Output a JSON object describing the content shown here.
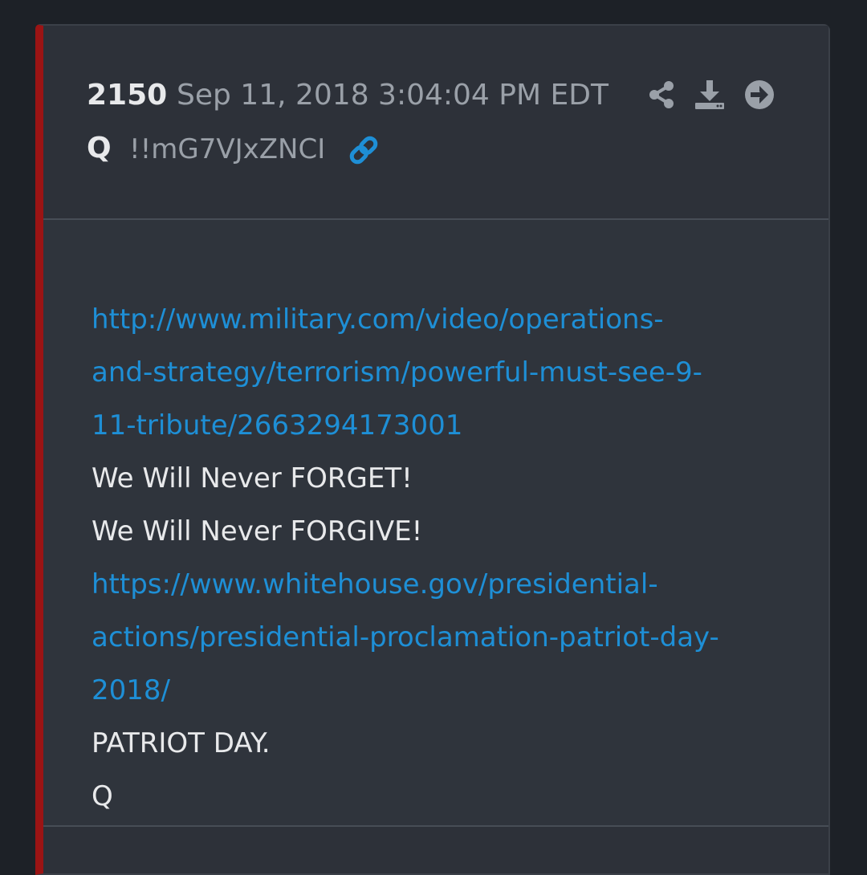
{
  "post": {
    "number": "2150",
    "date": "Sep 11, 2018 3:04:04 PM EDT",
    "author": "Q",
    "tripcode": "!!mG7VJxZNCI",
    "icons": {
      "permalink": "link-icon",
      "share": "share-icon",
      "download": "download-icon",
      "goto": "arrow-right-circle-icon"
    },
    "colors": {
      "accent_border": "#9b1414",
      "link": "#1e8fd6",
      "text": "#e8e9eb",
      "muted": "#9aa0a8"
    }
  },
  "body": {
    "link1_line1": "http://www.military.com/video/operations-",
    "link1_line2": "and-strategy/terrorism/powerful-must-see-9-",
    "link1_line3": "11-tribute/2663294173001",
    "line1": "We Will Never FORGET!",
    "line2": "We Will Never FORGIVE!",
    "link2_line1": "https://www.whitehouse.gov/presidential-",
    "link2_line2": "actions/presidential-proclamation-patriot-day-",
    "link2_line3": "2018/",
    "line3": "PATRIOT DAY.",
    "signature": "Q"
  }
}
